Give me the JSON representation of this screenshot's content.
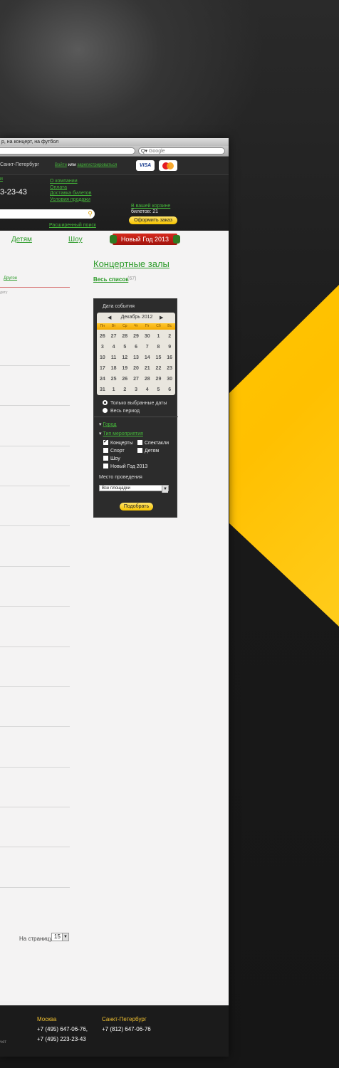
{
  "browser": {
    "title": "р, на концерт, на футбол",
    "search_placeholder": "Google",
    "search_icon": "magnifier-icon"
  },
  "topbar": {
    "city": "Санкт-Петербург",
    "login": "Войти",
    "or": "или",
    "register": "зарегистрироваться",
    "cards": [
      "VISA",
      "MasterCard"
    ]
  },
  "header": {
    "top_link": "и",
    "phone": "3-23-43",
    "links": [
      "О компании",
      "Оплата",
      "Доставка билетов",
      "Условия продажи"
    ],
    "advanced_search": "Расширенный поиск",
    "cart_link": "В вашей корзине",
    "cart_count": "билетов: 21",
    "order_button": "Оформить заказ"
  },
  "nav": {
    "items": [
      "Детям",
      "Шоу"
    ],
    "banner": "Новый Год 2013"
  },
  "main": {
    "other_tab": "Другое",
    "sort_label": "дату",
    "section_title": "Концертные залы",
    "all_list": "Весь список",
    "all_count": "(67)",
    "per_page_label": "На страницу",
    "per_page_value": "15"
  },
  "widget": {
    "title": "Дата события",
    "month": "Декабрь 2012",
    "weekdays": [
      "Пн",
      "Вт",
      "Ср",
      "Чт",
      "Пт",
      "Сб",
      "Вс"
    ],
    "weeks": [
      [
        "26",
        "27",
        "28",
        "29",
        "30",
        "1",
        "2"
      ],
      [
        "3",
        "4",
        "5",
        "6",
        "7",
        "8",
        "9"
      ],
      [
        "10",
        "11",
        "12",
        "13",
        "14",
        "15",
        "16"
      ],
      [
        "17",
        "18",
        "19",
        "20",
        "21",
        "22",
        "23"
      ],
      [
        "24",
        "25",
        "26",
        "27",
        "28",
        "29",
        "30"
      ],
      [
        "31",
        "1",
        "2",
        "3",
        "4",
        "5",
        "6"
      ]
    ],
    "radio_selected": "Только выбранные даты",
    "radio_all": "Весь период",
    "city_filter": "Город",
    "type_filter": "Тип мероприятия",
    "checkboxes": [
      "Концерты",
      "Спектакли",
      "Спорт",
      "Детям",
      "Шоу",
      "Новый Год 2013"
    ],
    "venue_label": "Место проведения",
    "venue_value": "Все площадки",
    "pick_button": "Подобрать"
  },
  "footer": {
    "moscow": "Москва",
    "moscow_phone1": "+7 (495) 647-06-76,",
    "moscow_phone2": "+7 (495) 223-23-43",
    "spb": "Санкт-Петербург",
    "spb_phone": "+7 (812) 647-06-76",
    "left_text": "чет"
  },
  "colors": {
    "green": "#2d9b2a",
    "yellow": "#ffc000",
    "dark": "#2c2c2c"
  }
}
